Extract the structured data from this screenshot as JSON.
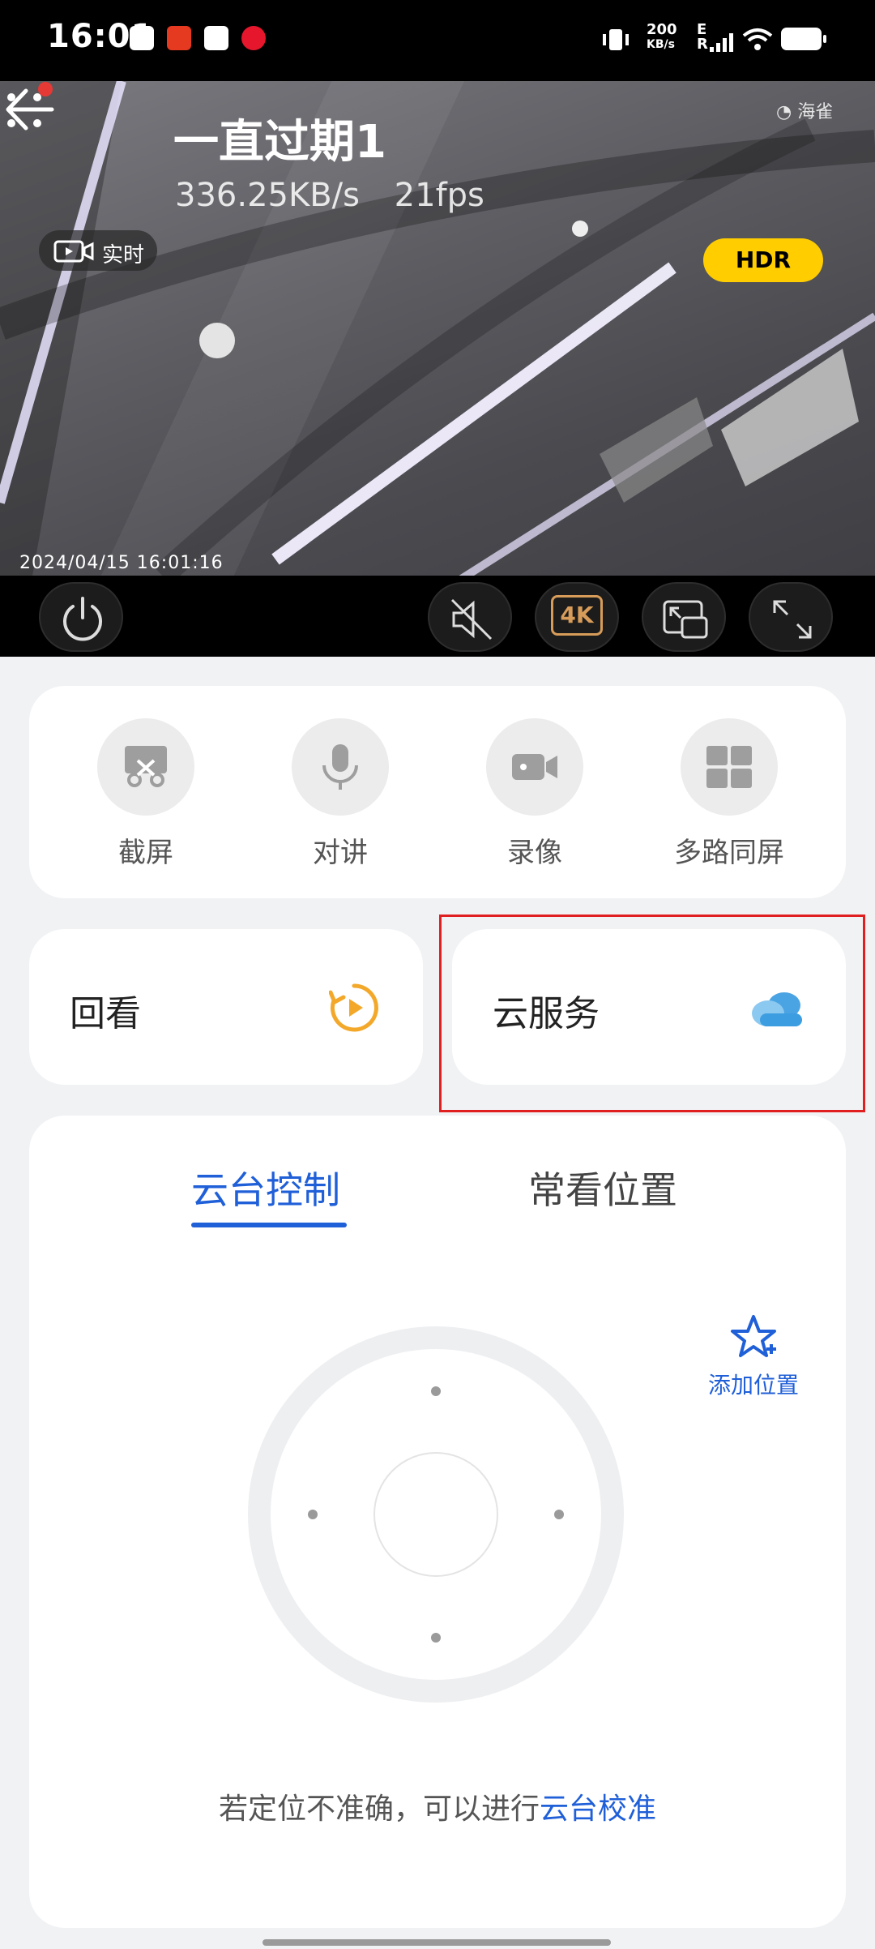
{
  "status_bar": {
    "time": "16:01",
    "net_speed": "200",
    "net_unit": "KB/s",
    "network_type": "E",
    "roaming": "R"
  },
  "camera": {
    "title": "一直过期1",
    "bitrate": "336.25KB/s",
    "fps": "21fps",
    "live_label": "实时",
    "hdr_label": "HDR",
    "logo_text": "海雀",
    "timestamp": "2024/04/15  16:01:16"
  },
  "controls": {
    "quality_label": "4K"
  },
  "quick_actions": [
    {
      "label": "截屏",
      "icon": "screenshot-icon"
    },
    {
      "label": "对讲",
      "icon": "microphone-icon"
    },
    {
      "label": "录像",
      "icon": "video-record-icon"
    },
    {
      "label": "多路同屏",
      "icon": "multi-screen-icon"
    }
  ],
  "tiles": {
    "playback_label": "回看",
    "cloud_label": "云服务"
  },
  "ptz_panel": {
    "tabs": [
      "云台控制",
      "常看位置"
    ],
    "active_tab": 0,
    "add_position_label": "添加位置",
    "hint_text": "若定位不准确，可以进行",
    "hint_link": "云台校准"
  },
  "colors": {
    "accent": "#1f5fd8",
    "hdr": "#ffcd00",
    "playback": "#f3a82a",
    "cloud": "#3c9de0",
    "highlight": "#e02020"
  }
}
